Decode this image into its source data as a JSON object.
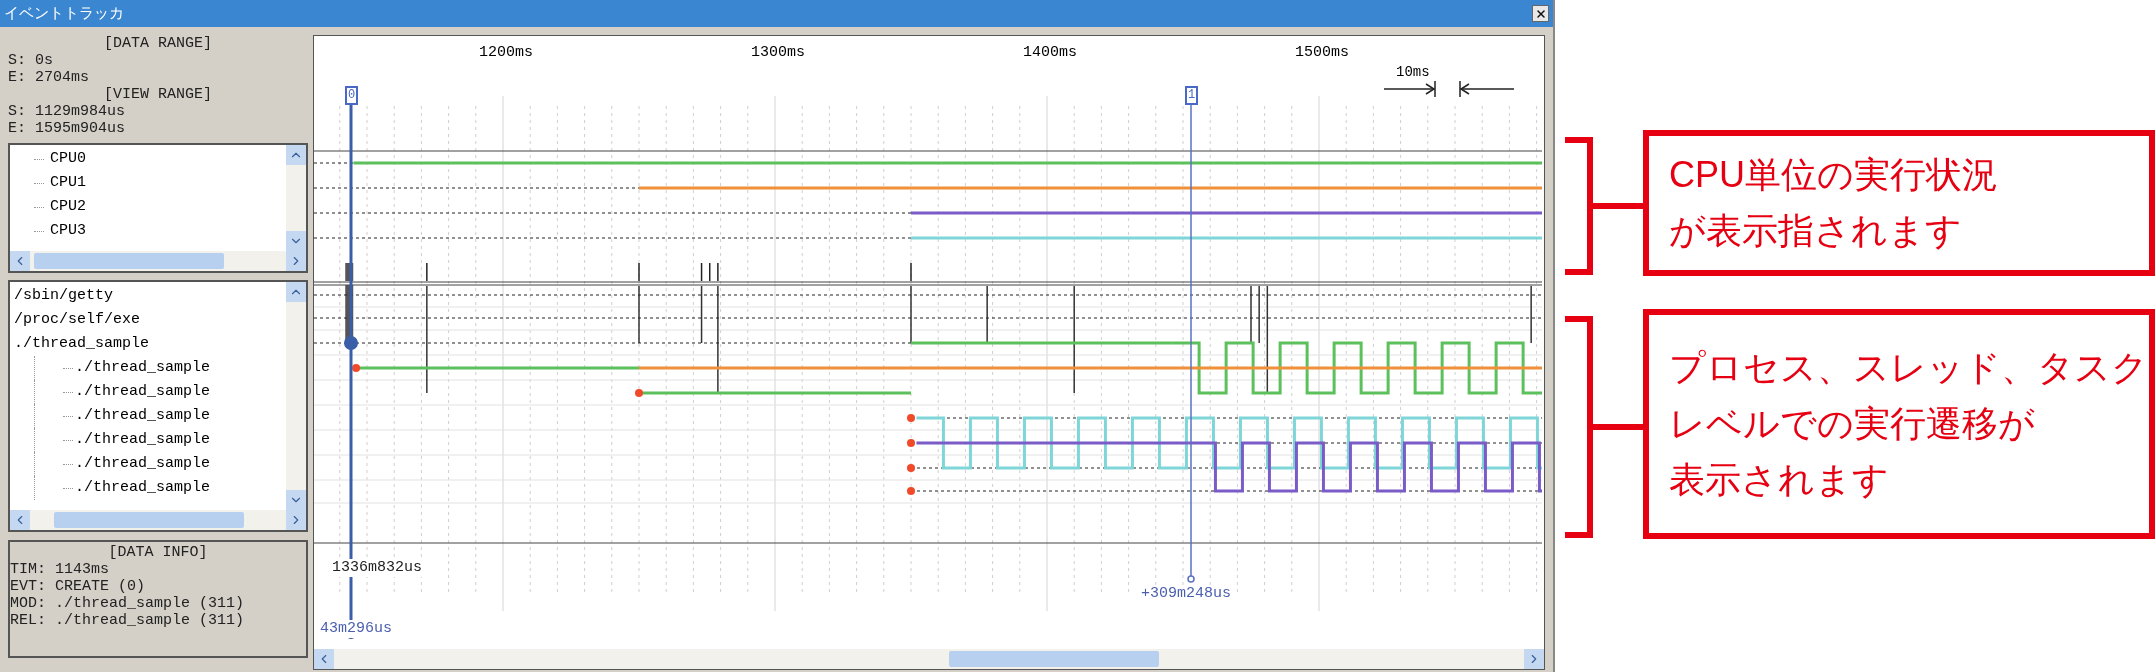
{
  "window": {
    "title": "イベントトラッカ"
  },
  "info_panel": {
    "data_range": {
      "heading": "[DATA RANGE]",
      "start": "S: 0s",
      "end": "E: 2704ms"
    },
    "view_range": {
      "heading": "[VIEW RANGE]",
      "start": "S: 1129m984us",
      "end": "E: 1595m904us"
    }
  },
  "cpu_list": {
    "items": [
      "CPU0",
      "CPU1",
      "CPU2",
      "CPU3"
    ]
  },
  "process_list": {
    "items": [
      {
        "label": "/sbin/getty"
      },
      {
        "label": "/proc/self/exe"
      },
      {
        "label": "./thread_sample",
        "children": [
          {
            "label": "./thread_sample"
          },
          {
            "label": "./thread_sample"
          },
          {
            "label": "./thread_sample"
          },
          {
            "label": "./thread_sample"
          },
          {
            "label": "./thread_sample"
          },
          {
            "label": "./thread_sample"
          }
        ]
      }
    ]
  },
  "data_info": {
    "heading": "[DATA INFO]",
    "lines": [
      "TIM: 1143ms",
      "EVT: CREATE (0)",
      "MOD: ./thread_sample (311)",
      "REL: ./thread_sample (311)"
    ]
  },
  "timeline": {
    "ruler_labels": [
      "1200ms",
      "1300ms",
      "1400ms",
      "1500ms"
    ],
    "scale_label": "10ms",
    "markers": [
      "0",
      "1"
    ],
    "readouts": [
      {
        "kind": "position",
        "text": "1336m832us"
      },
      {
        "kind": "delta",
        "text": "+309m248us"
      },
      {
        "kind": "origin",
        "text": "43m296us"
      }
    ]
  },
  "annotations": [
    {
      "lines": [
        "CPU単位の実行状況",
        "が表示指されます"
      ]
    },
    {
      "lines": [
        "プロセス、スレッド、タスク",
        "レベルでの実行遷移が",
        "表示されます"
      ]
    }
  ]
}
